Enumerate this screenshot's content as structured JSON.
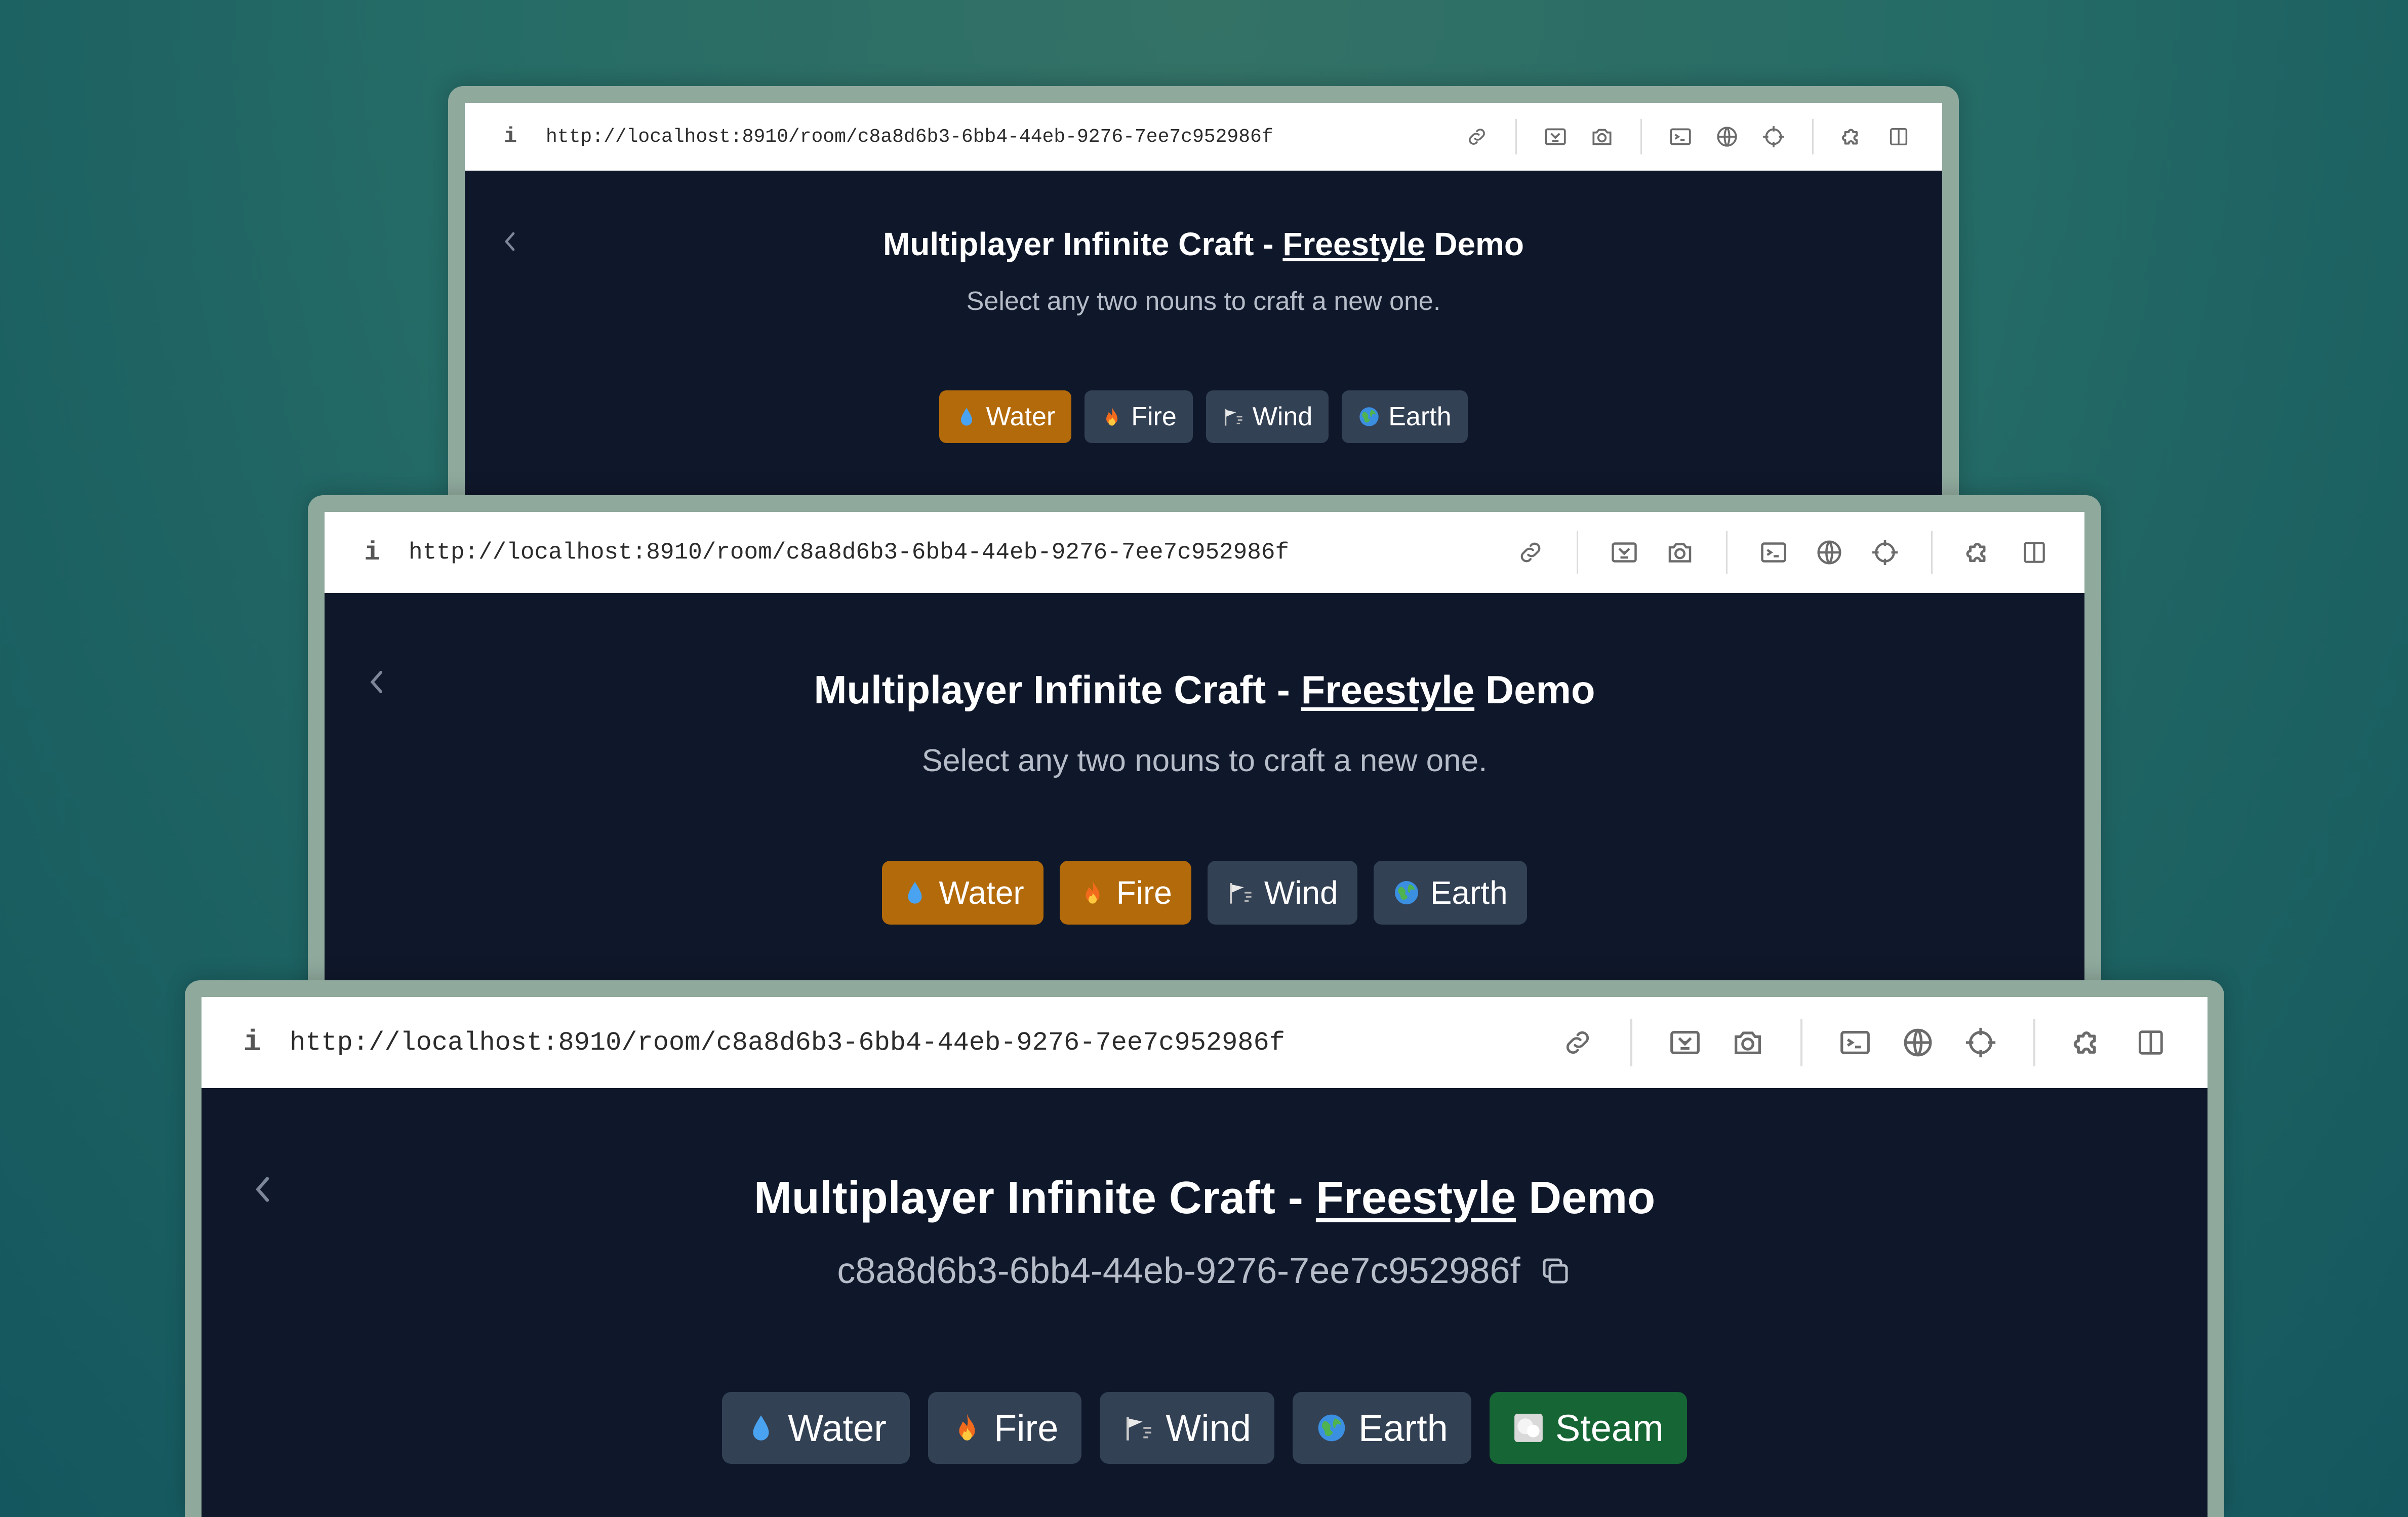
{
  "browser": {
    "info_label": "i",
    "url": "http://localhost:8910/room/c8a8d6b3-6bb4-44eb-9276-7ee7c952986f",
    "toolbar_icons": [
      "link-icon",
      "screenshot-element-icon",
      "camera-icon",
      "terminal-icon",
      "globe-icon",
      "crosshair-icon",
      "extension-icon",
      "split-view-icon"
    ]
  },
  "windows": [
    {
      "title_prefix": "Multiplayer Infinite Craft - ",
      "title_link": "Freestyle",
      "title_suffix": " Demo",
      "subtitle": "Select any two nouns to craft a new one.",
      "chips": [
        {
          "label": "Water",
          "icon": "droplet-icon",
          "state": "selected"
        },
        {
          "label": "Fire",
          "icon": "fire-icon",
          "state": "default"
        },
        {
          "label": "Wind",
          "icon": "wind-icon",
          "state": "default"
        },
        {
          "label": "Earth",
          "icon": "globe-earth-icon",
          "state": "default"
        }
      ]
    },
    {
      "title_prefix": "Multiplayer Infinite Craft - ",
      "title_link": "Freestyle",
      "title_suffix": " Demo",
      "subtitle": "Select any two nouns to craft a new one.",
      "chips": [
        {
          "label": "Water",
          "icon": "droplet-icon",
          "state": "selected"
        },
        {
          "label": "Fire",
          "icon": "fire-icon",
          "state": "selected"
        },
        {
          "label": "Wind",
          "icon": "wind-icon",
          "state": "default"
        },
        {
          "label": "Earth",
          "icon": "globe-earth-icon",
          "state": "default"
        }
      ]
    },
    {
      "title_prefix": "Multiplayer Infinite Craft - ",
      "title_link": "Freestyle",
      "title_suffix": " Demo",
      "subtitle": "c8a8d6b3-6bb4-44eb-9276-7ee7c952986f",
      "chips": [
        {
          "label": "Water",
          "icon": "droplet-icon",
          "state": "default"
        },
        {
          "label": "Fire",
          "icon": "fire-icon",
          "state": "default"
        },
        {
          "label": "Wind",
          "icon": "wind-icon",
          "state": "default"
        },
        {
          "label": "Earth",
          "icon": "globe-earth-icon",
          "state": "default"
        },
        {
          "label": "Steam",
          "icon": "steam-icon",
          "state": "new"
        }
      ]
    }
  ],
  "colors": {
    "selected_chip": "#b36a0a",
    "default_chip": "#334155",
    "new_chip": "#166534",
    "app_background": "#0f172a"
  }
}
